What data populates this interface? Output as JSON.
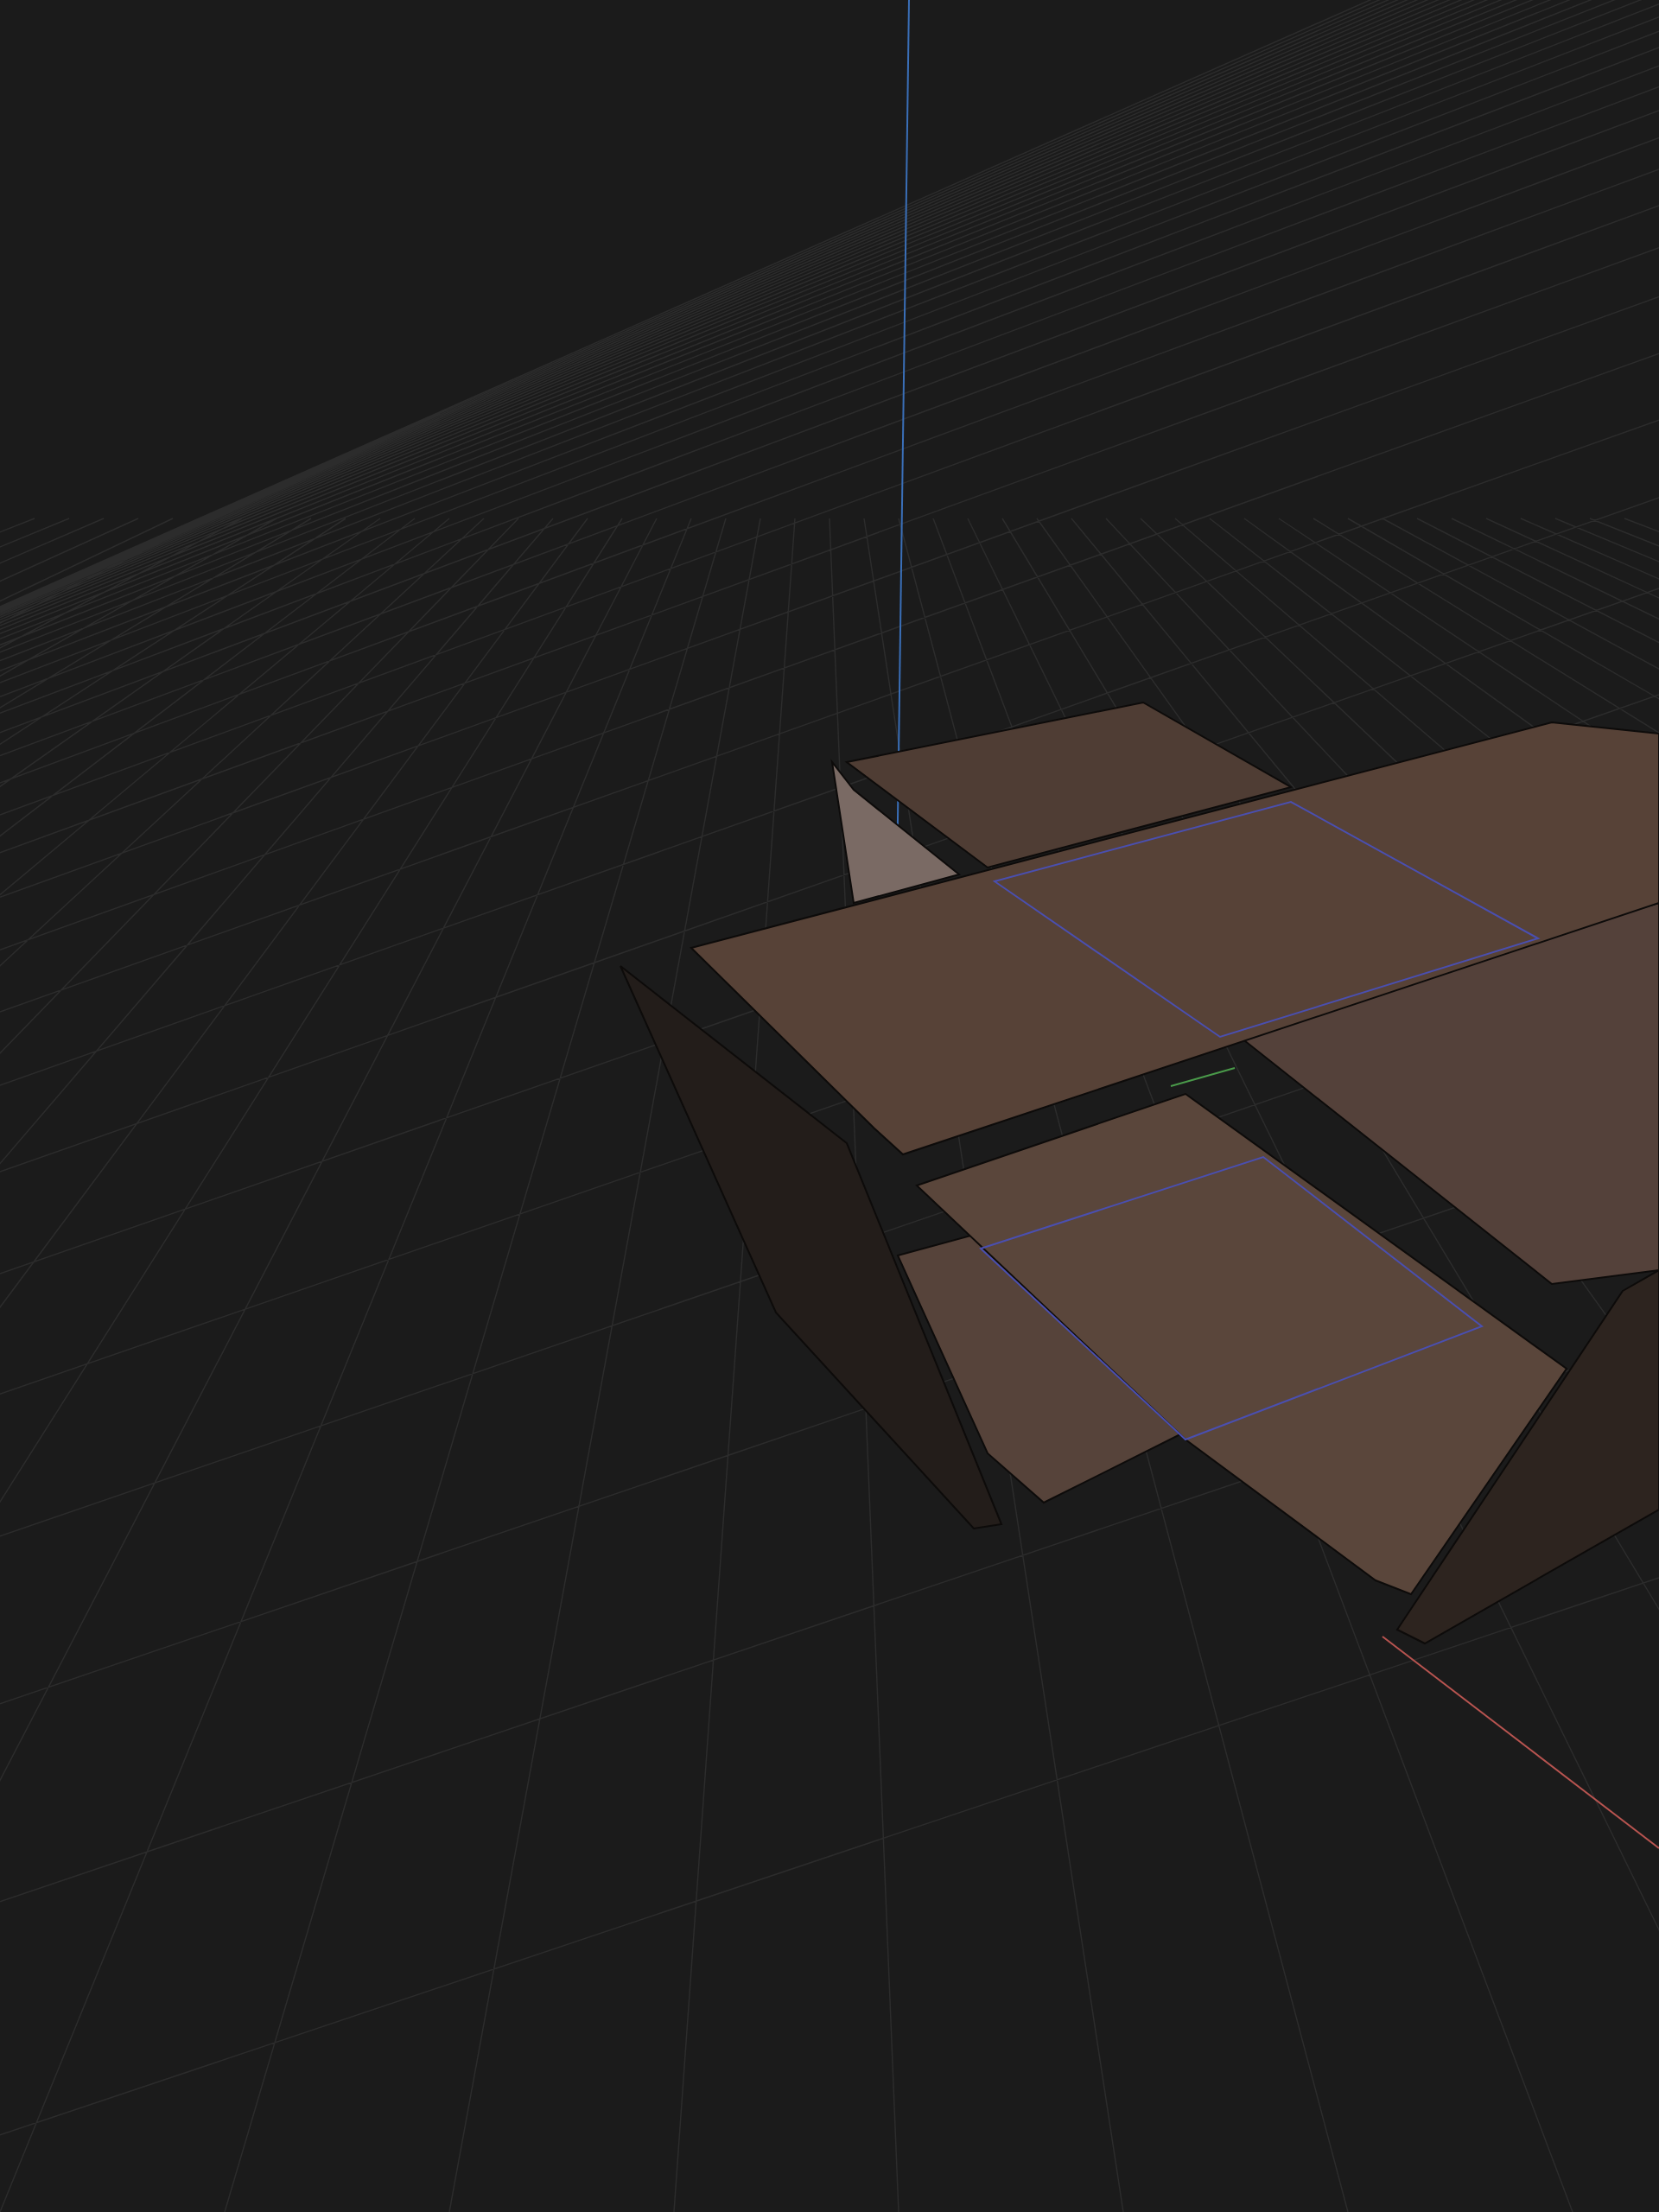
{
  "viewport": {
    "axes": [
      {
        "kind": "z",
        "color": "#3a6fb8"
      },
      {
        "kind": "x",
        "color": "#b85450"
      },
      {
        "kind": "y",
        "color": "#4a9a4a"
      }
    ]
  }
}
